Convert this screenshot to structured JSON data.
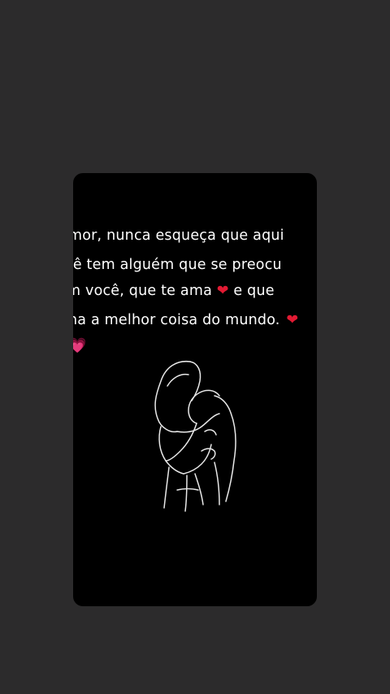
{
  "story": {
    "caption_lines": [
      "mor, nunca esqueça que aqui",
      "cê tem alguém que se preocu",
      "m você, que te ama",
      "na a melhor coisa do mundo."
    ],
    "line3_tail": "e que",
    "heart_red": "❤",
    "heart_pink": "💗",
    "heart_edge": "❤"
  },
  "illustration": {
    "icon": "couple-hug-line-art-icon",
    "stroke_color": "#e8e8e8"
  },
  "colors": {
    "background": "#2c2b2c",
    "card": "#000000",
    "text": "#ffffff",
    "heart_red": "#e21a33",
    "heart_pink": "#ff2b7a"
  }
}
